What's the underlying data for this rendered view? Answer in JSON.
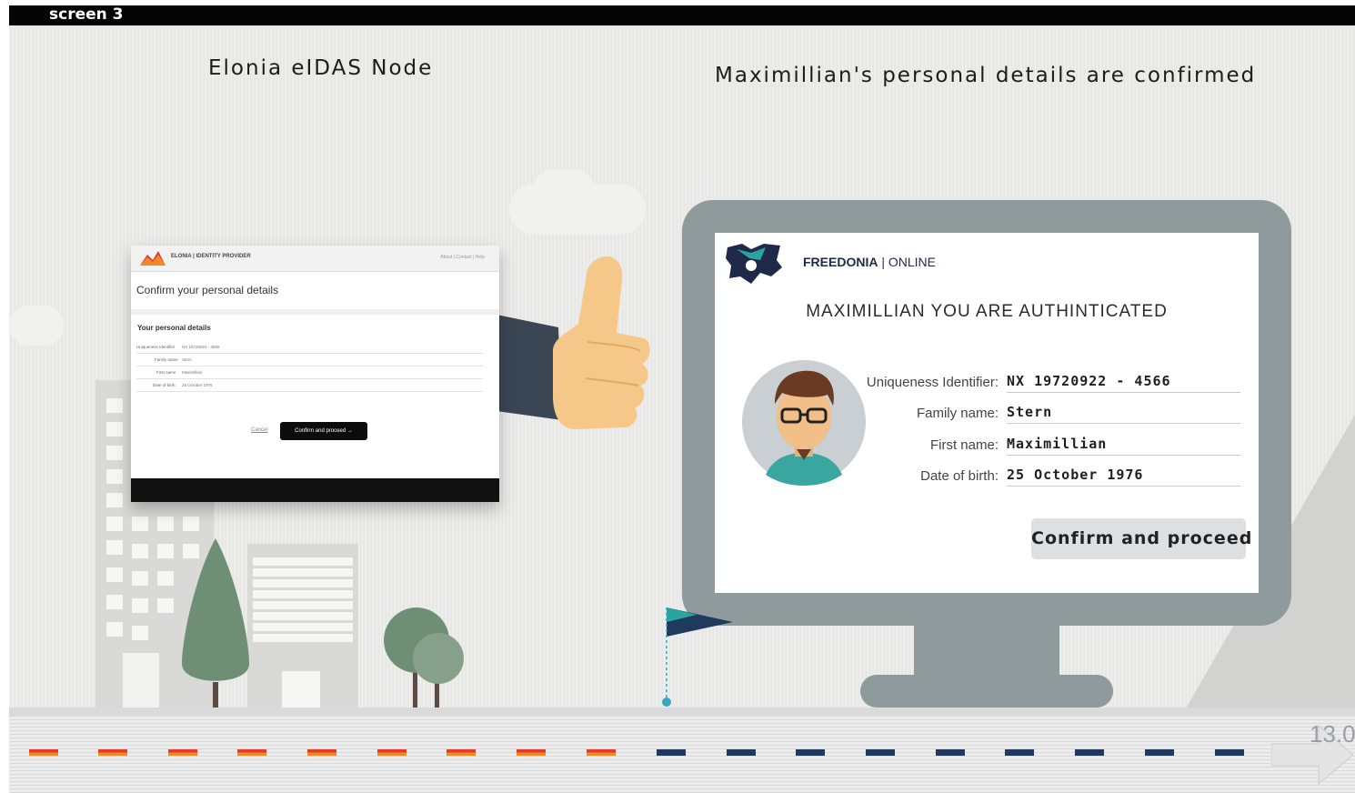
{
  "topbar": {
    "label": "screen 3"
  },
  "headings": {
    "left": "Elonia eIDAS Node",
    "right": "Maximillian's personal details are confirmed"
  },
  "small_screen": {
    "brand": "ELONIA | IDENTITY PROVIDER",
    "header_links": "About | Contact | Help",
    "title": "Confirm your personal details",
    "subtitle": "Your personal details",
    "fields": [
      {
        "label": "Uniqueness Identifier",
        "value": "NX 19720922 - 4566"
      },
      {
        "label": "Family name",
        "value": "Stern"
      },
      {
        "label": "First name",
        "value": "Maximillian"
      },
      {
        "label": "Date of birth",
        "value": "25 October 1976"
      }
    ],
    "cancel_label": "Cancel",
    "confirm_label": "Confirm and proceed →"
  },
  "monitor": {
    "brand_name": "FREEDONIA",
    "brand_suffix": " | ONLINE",
    "auth_message": "MAXIMILLIAN YOU ARE AUTHINTICATED",
    "fields": [
      {
        "label": "Uniqueness Identifier:",
        "value": "NX 19720922 - 4566"
      },
      {
        "label": "Family name:",
        "value": "Stern"
      },
      {
        "label": "First name:",
        "value": "Maximillian"
      },
      {
        "label": "Date of birth:",
        "value": "25 October 1976"
      }
    ],
    "confirm_label": "Confirm and proceed"
  },
  "page_number": "13.0",
  "colors": {
    "road_elonia": [
      "#e23a2b",
      "#f08a24"
    ],
    "road_freedonia": "#1f3a5c",
    "flag": "#1f3a5c",
    "monitor": "#8e9a9c",
    "tree": "#6f8f75"
  },
  "icons": [
    "elonia-logo-icon",
    "freedonia-logo-icon",
    "thumbs-up-icon",
    "avatar-icon",
    "flag-icon",
    "arrow-icon"
  ]
}
